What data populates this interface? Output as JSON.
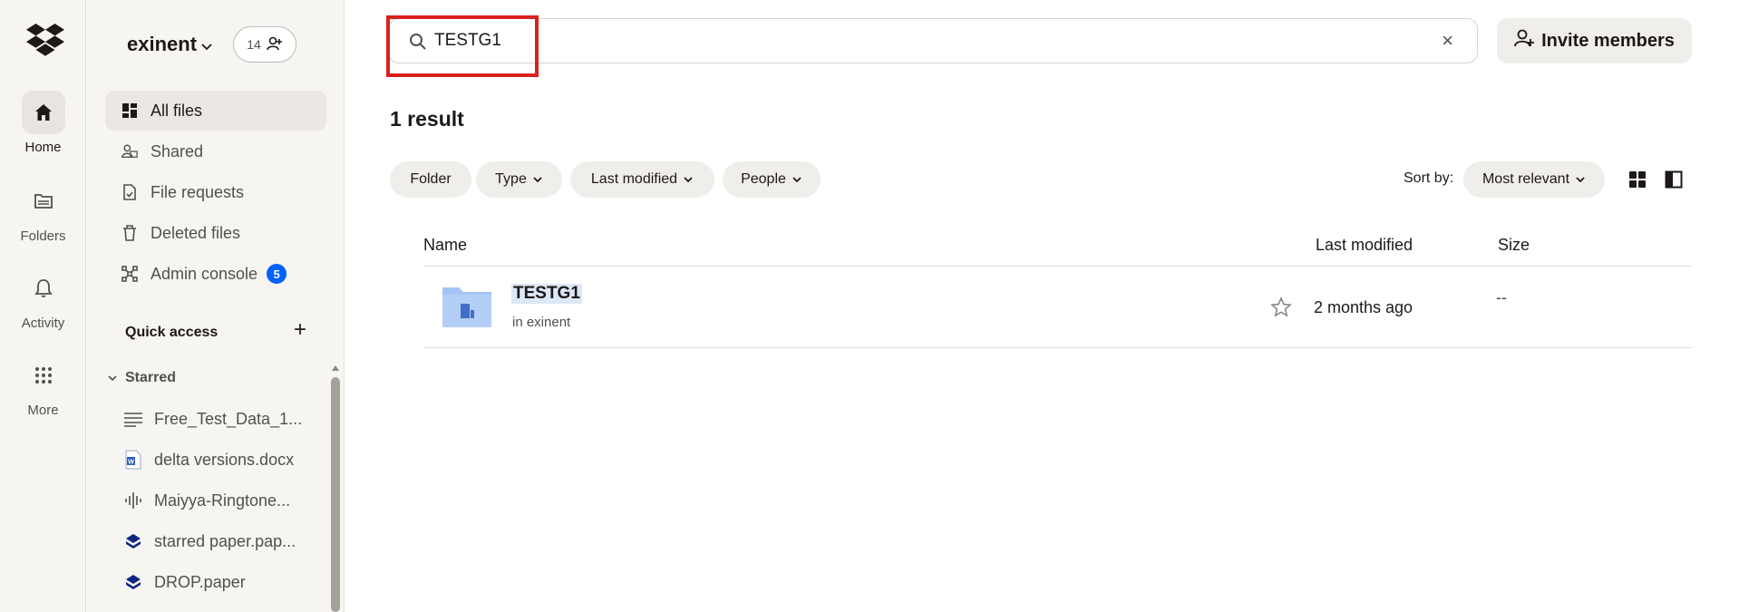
{
  "rail": {
    "items": [
      {
        "label": "Home",
        "icon": "home-icon",
        "active": true
      },
      {
        "label": "Folders",
        "icon": "folder-icon"
      },
      {
        "label": "Activity",
        "icon": "bell-icon"
      },
      {
        "label": "More",
        "icon": "grid-icon"
      }
    ]
  },
  "sidebar": {
    "team_name": "exinent",
    "member_count": "14",
    "nav": [
      {
        "label": "All files",
        "icon": "all-files-icon",
        "active": true
      },
      {
        "label": "Shared",
        "icon": "shared-icon"
      },
      {
        "label": "File requests",
        "icon": "file-request-icon"
      },
      {
        "label": "Deleted files",
        "icon": "trash-icon"
      },
      {
        "label": "Admin console",
        "icon": "admin-icon",
        "badge": "5"
      }
    ],
    "quick_access_label": "Quick access",
    "starred_label": "Starred",
    "starred_items": [
      {
        "label": "Free_Test_Data_1...",
        "icon": "text-file-icon"
      },
      {
        "label": "delta versions.docx",
        "icon": "word-doc-icon"
      },
      {
        "label": "Maiyya-Ringtone...",
        "icon": "audio-file-icon"
      },
      {
        "label": "starred paper.pap...",
        "icon": "paper-doc-icon"
      },
      {
        "label": "DROP.paper",
        "icon": "paper-doc-icon"
      }
    ]
  },
  "search": {
    "value": "TESTG1",
    "clear_glyph": "×"
  },
  "invite_label": "Invite members",
  "result_count": "1 result",
  "filters": {
    "folder": "Folder",
    "type": "Type",
    "last_modified": "Last modified",
    "people": "People"
  },
  "sort": {
    "label": "Sort by:",
    "value": "Most relevant"
  },
  "table": {
    "headers": {
      "name": "Name",
      "modified": "Last modified",
      "size": "Size"
    },
    "rows": [
      {
        "name": "TESTG1",
        "path": "in exinent",
        "modified": "2 months ago",
        "size": "--"
      }
    ]
  },
  "colors": {
    "accent": "#0061fe",
    "highlight": "#d9211f",
    "folder": "#a3c4f5"
  }
}
